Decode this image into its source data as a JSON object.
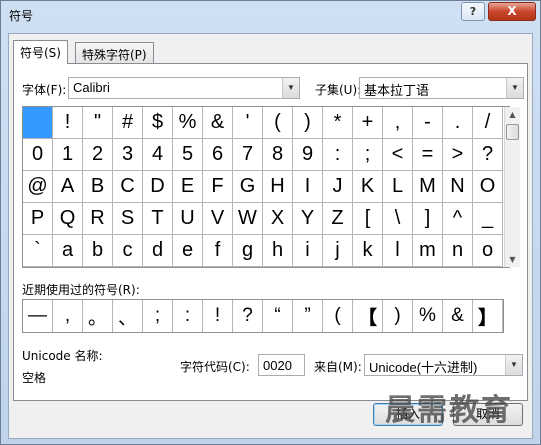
{
  "window": {
    "title": "符号",
    "help_label": "?",
    "close_label": "X"
  },
  "tabs": [
    {
      "label": "符号(S)",
      "active": true
    },
    {
      "label": "特殊字符(P)",
      "active": false
    }
  ],
  "font_label": "字体(F):",
  "font_value": "Calibri",
  "subset_label": "子集(U):",
  "subset_value": "基本拉丁语",
  "symbol_grid": [
    [
      "",
      "!",
      "\"",
      "#",
      "$",
      "%",
      "&",
      "'",
      "(",
      ")",
      "*",
      "+",
      ",",
      "-",
      ".",
      "/"
    ],
    [
      "0",
      "1",
      "2",
      "3",
      "4",
      "5",
      "6",
      "7",
      "8",
      "9",
      ":",
      ";",
      "<",
      "=",
      ">",
      "?"
    ],
    [
      "@",
      "A",
      "B",
      "C",
      "D",
      "E",
      "F",
      "G",
      "H",
      "I",
      "J",
      "K",
      "L",
      "M",
      "N",
      "O"
    ],
    [
      "P",
      "Q",
      "R",
      "S",
      "T",
      "U",
      "V",
      "W",
      "X",
      "Y",
      "Z",
      "[",
      "\\",
      "]",
      "^",
      "_"
    ],
    [
      "`",
      "a",
      "b",
      "c",
      "d",
      "e",
      "f",
      "g",
      "h",
      "i",
      "j",
      "k",
      "l",
      "m",
      "n",
      "o"
    ]
  ],
  "recent_label": "近期使用过的符号(R):",
  "recent_symbols": [
    "—",
    ",",
    "。",
    "、",
    ";",
    ":",
    "!",
    "?",
    "“",
    "”",
    "(",
    "【",
    ")",
    "%",
    "&",
    "】"
  ],
  "unicode_name_label": "Unicode 名称:",
  "unicode_name_value": "空格",
  "char_code_label": "字符代码(C):",
  "char_code_value": "0020",
  "from_label": "来自(M):",
  "from_value": "Unicode(十六进制)",
  "buttons": {
    "insert": "插入",
    "cancel": "取消"
  },
  "watermark": "晨需教育",
  "colors": {
    "selection": "#3399ff",
    "close_button": "#c9462c"
  }
}
